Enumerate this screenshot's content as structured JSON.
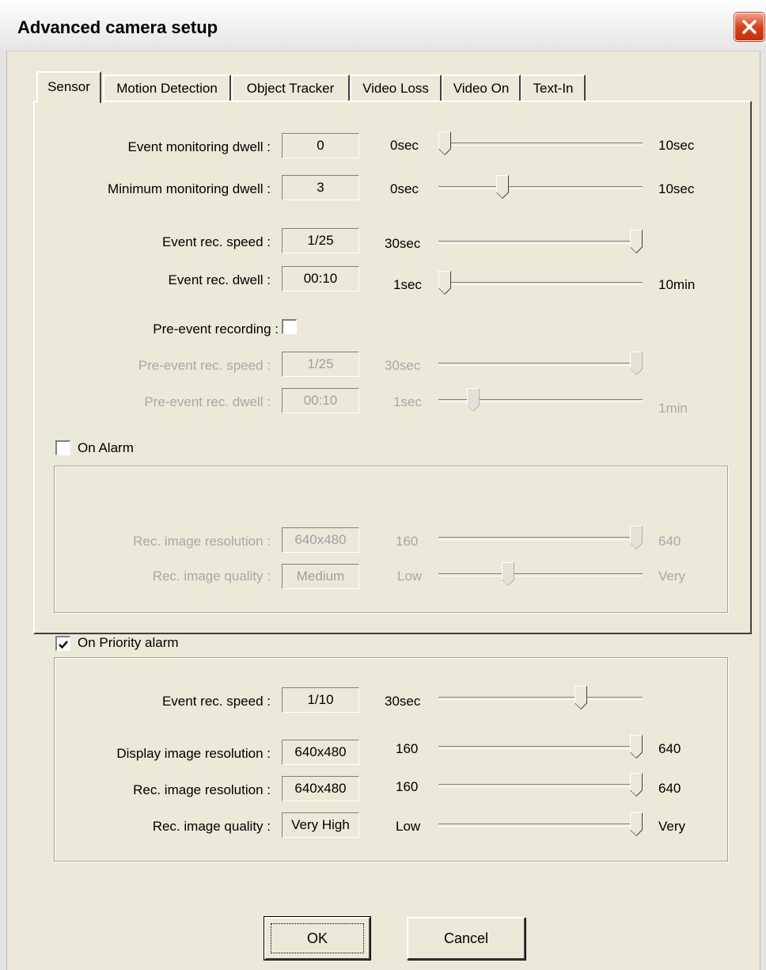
{
  "window": {
    "title": "Advanced camera setup"
  },
  "tabs": [
    "Sensor",
    "Motion Detection",
    "Object Tracker",
    "Video Loss",
    "Video On",
    "Text-In"
  ],
  "active_tab": "Sensor",
  "sensor": {
    "event_monitoring_dwell": {
      "label": "Event monitoring dwell :",
      "value": "0",
      "min": "0sec",
      "max": "10sec",
      "level": 0.0
    },
    "minimum_monitoring_dwell": {
      "label": "Minimum monitoring dwell :",
      "value": "3",
      "min": "0sec",
      "max": "10sec",
      "level": 0.3
    },
    "event_rec_speed": {
      "label": "Event rec. speed :",
      "value": "1/25",
      "min": "30sec",
      "max": "",
      "level": 1.0
    },
    "event_rec_dwell": {
      "label": "Event rec. dwell :",
      "value": "00:10",
      "min": "1sec",
      "max": "10min",
      "level": 0.0
    },
    "pre_event_recording": {
      "label": "Pre-event recording :",
      "checked": false
    },
    "pre_event_rec_speed": {
      "label": "Pre-event rec. speed :",
      "value": "1/25",
      "min": "30sec",
      "max": "",
      "level": 1.0
    },
    "pre_event_rec_dwell": {
      "label": "Pre-event rec. dwell :",
      "value": "00:10",
      "min": "1sec",
      "max": "1min",
      "level": 0.15
    }
  },
  "on_alarm": {
    "label": "On Alarm",
    "checked": false,
    "rec_image_resolution": {
      "label": "Rec. image resolution :",
      "value": "640x480",
      "min": "160",
      "max": "640",
      "level": 1.0
    },
    "rec_image_quality": {
      "label": "Rec. image quality :",
      "value": "Medium",
      "min": "Low",
      "max": "Very",
      "level": 0.33
    }
  },
  "on_priority_alarm": {
    "label": "On Priority alarm",
    "checked": true,
    "event_rec_speed": {
      "label": "Event rec. speed :",
      "value": "1/10",
      "min": "30sec",
      "max": "",
      "level": 0.71
    },
    "display_image_resolution": {
      "label": "Display image resolution :",
      "value": "640x480",
      "min": "160",
      "max": "640",
      "level": 1.0
    },
    "rec_image_resolution": {
      "label": "Rec. image resolution :",
      "value": "640x480",
      "min": "160",
      "max": "640",
      "level": 1.0
    },
    "rec_image_quality": {
      "label": "Rec. image quality :",
      "value": "Very High",
      "min": "Low",
      "max": "Very",
      "level": 1.0
    }
  },
  "buttons": {
    "ok": "OK",
    "cancel": "Cancel"
  },
  "colors": {
    "dialog_bg": "#ece9d8",
    "close_red": "#d9431e",
    "disabled_text": "#a8a8a8"
  }
}
